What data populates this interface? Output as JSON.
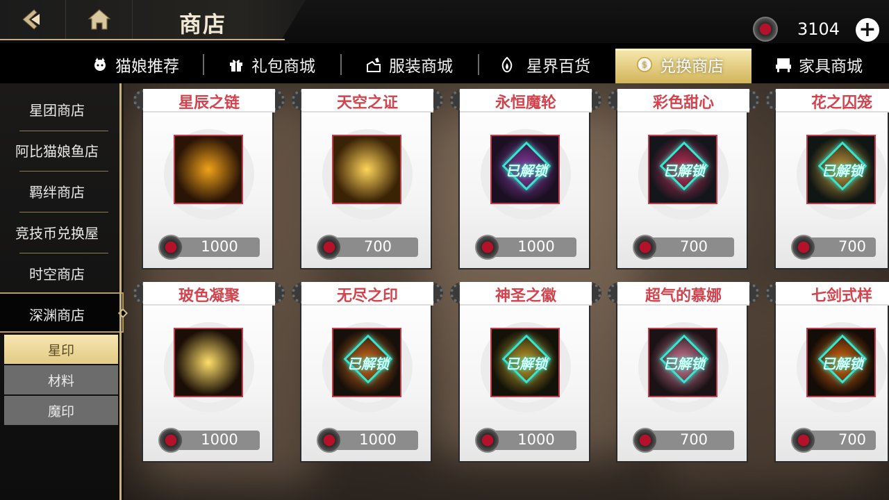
{
  "header": {
    "title": "商店",
    "currency_icon": "red-gem-coin-icon",
    "currency_amount": "3104",
    "add_label": "+"
  },
  "tabs": [
    {
      "label": "猫娘推荐",
      "icon": "cat-icon",
      "active": false
    },
    {
      "label": "礼包商城",
      "icon": "gift-icon",
      "active": false
    },
    {
      "label": "服装商城",
      "icon": "outfit-icon",
      "active": false
    },
    {
      "label": "星界百货",
      "icon": "flame-icon",
      "active": false
    },
    {
      "label": "兑换商店",
      "icon": "coin-icon",
      "active": true
    },
    {
      "label": "家具商城",
      "icon": "chair-icon",
      "active": false
    }
  ],
  "sidebar": {
    "items": [
      {
        "label": "星团商店"
      },
      {
        "label": "阿比猫娘鱼店"
      },
      {
        "label": "羁绊商店"
      },
      {
        "label": "竞技币兑换屋"
      },
      {
        "label": "时空商店"
      },
      {
        "label": "深渊商店",
        "active": true
      }
    ],
    "subitems": [
      {
        "label": "星印",
        "active": true
      },
      {
        "label": "材料",
        "active": false
      },
      {
        "label": "魔印",
        "active": false
      }
    ]
  },
  "unlock_label": "已解锁",
  "items": [
    {
      "name": "星辰之链",
      "price": "1000",
      "unlocked": false,
      "palette": [
        "#2a1406",
        "#f0a21a"
      ]
    },
    {
      "name": "天空之证",
      "price": "700",
      "unlocked": false,
      "palette": [
        "#3a2205",
        "#ffd45a"
      ]
    },
    {
      "name": "永恒魔轮",
      "price": "1000",
      "unlocked": true,
      "palette": [
        "#1c0f22",
        "#8a3ea8"
      ]
    },
    {
      "name": "彩色甜心",
      "price": "700",
      "unlocked": true,
      "palette": [
        "#14161c",
        "#c8305a"
      ]
    },
    {
      "name": "花之囚笼",
      "price": "700",
      "unlocked": true,
      "palette": [
        "#101614",
        "#c89a3a"
      ]
    },
    {
      "name": "玻色凝聚",
      "price": "1000",
      "unlocked": false,
      "palette": [
        "#1a0e06",
        "#ffdf6a"
      ]
    },
    {
      "name": "无尽之印",
      "price": "1000",
      "unlocked": true,
      "palette": [
        "#16100a",
        "#d86a1a"
      ]
    },
    {
      "name": "神圣之徽",
      "price": "1000",
      "unlocked": true,
      "palette": [
        "#121208",
        "#c8a02a"
      ]
    },
    {
      "name": "超气的慕娜",
      "price": "700",
      "unlocked": true,
      "palette": [
        "#1a1214",
        "#d87a9a"
      ]
    },
    {
      "name": "七剑式样",
      "price": "700",
      "unlocked": true,
      "palette": [
        "#140c06",
        "#e06a10"
      ]
    }
  ]
}
